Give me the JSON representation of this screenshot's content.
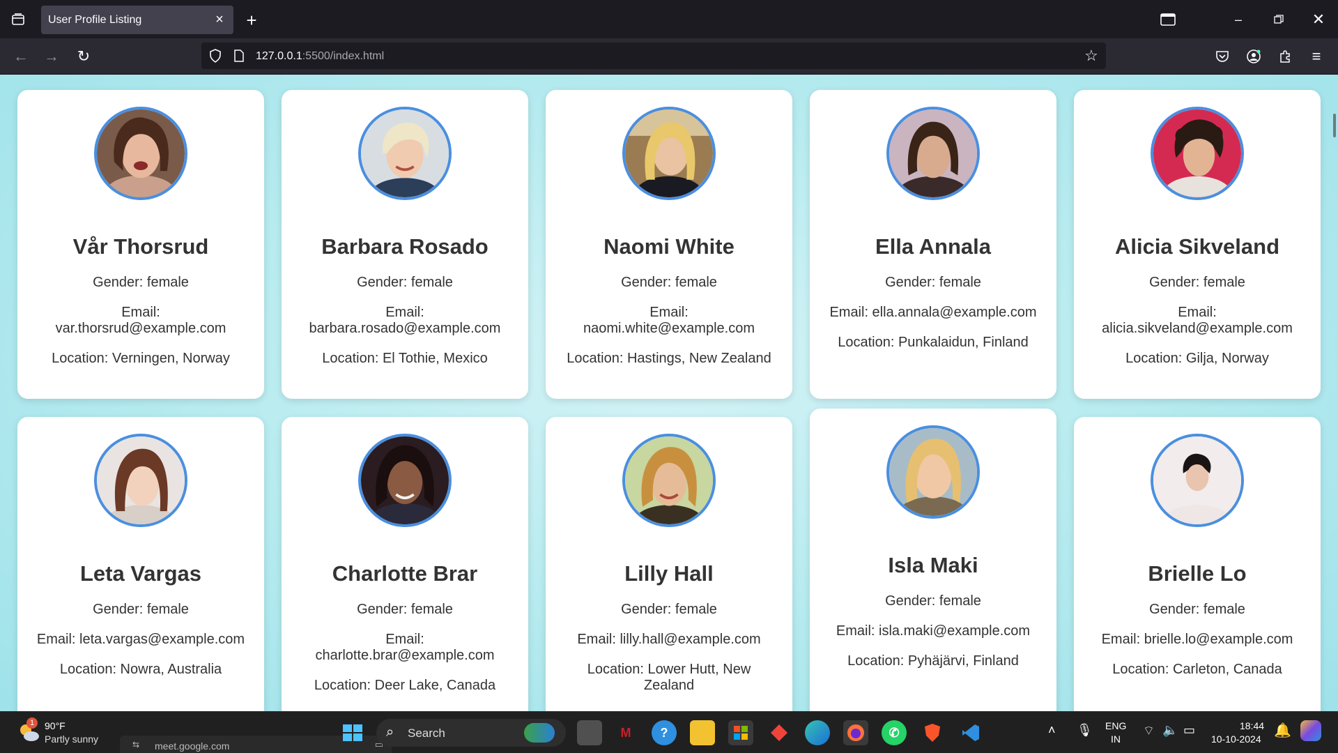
{
  "browser": {
    "tab_title": "User Profile Listing",
    "url_host": "127.0.0.1",
    "url_rest": ":5500/index.html"
  },
  "cards": [
    {
      "name": "Vår Thorsrud",
      "gender": "Gender: female",
      "email_label": "Email:",
      "email": "var.thorsrud@example.com",
      "location": "Location: Verningen, Norway"
    },
    {
      "name": "Barbara Rosado",
      "gender": "Gender: female",
      "email_label": "Email:",
      "email": "barbara.rosado@example.com",
      "location": "Location: El Tothie, Mexico"
    },
    {
      "name": "Naomi White",
      "gender": "Gender: female",
      "email_label": "Email:",
      "email": "naomi.white@example.com",
      "location": "Location: Hastings, New Zealand"
    },
    {
      "name": "Ella Annala",
      "gender": "Gender: female",
      "email_full": "Email: ella.annala@example.com",
      "location": "Location: Punkalaidun, Finland"
    },
    {
      "name": "Alicia Sikveland",
      "gender": "Gender: female",
      "email_label": "Email:",
      "email": "alicia.sikveland@example.com",
      "location": "Location: Gilja, Norway"
    },
    {
      "name": "Leta Vargas",
      "gender": "Gender: female",
      "email_full": "Email: leta.vargas@example.com",
      "location": "Location: Nowra, Australia"
    },
    {
      "name": "Charlotte Brar",
      "gender": "Gender: female",
      "email_label": "Email:",
      "email": "charlotte.brar@example.com",
      "location": "Location: Deer Lake, Canada"
    },
    {
      "name": "Lilly Hall",
      "gender": "Gender: female",
      "email_full": "Email: lilly.hall@example.com",
      "location_l1": "Location: Lower Hutt, New",
      "location_l2": "Zealand"
    },
    {
      "name": "Isla Maki",
      "gender": "Gender: female",
      "email_full": "Email: isla.maki@example.com",
      "location": "Location: Pyhäjärvi, Finland"
    },
    {
      "name": "Brielle Lo",
      "gender": "Gender: female",
      "email_full": "Email: brielle.lo@example.com",
      "location": "Location: Carleton, Canada"
    }
  ],
  "taskbar": {
    "weather_temp": "90°F",
    "weather_desc": "Partly sunny",
    "weather_badge": "1",
    "search_label": "Search",
    "lang_1": "ENG",
    "lang_2": "IN",
    "time": "18:44",
    "date": "10-10-2024",
    "preview_text": "meet.google.com"
  },
  "colors": {
    "accent_border": "#4a8fe0",
    "page_bg": "#b9ecf0"
  }
}
